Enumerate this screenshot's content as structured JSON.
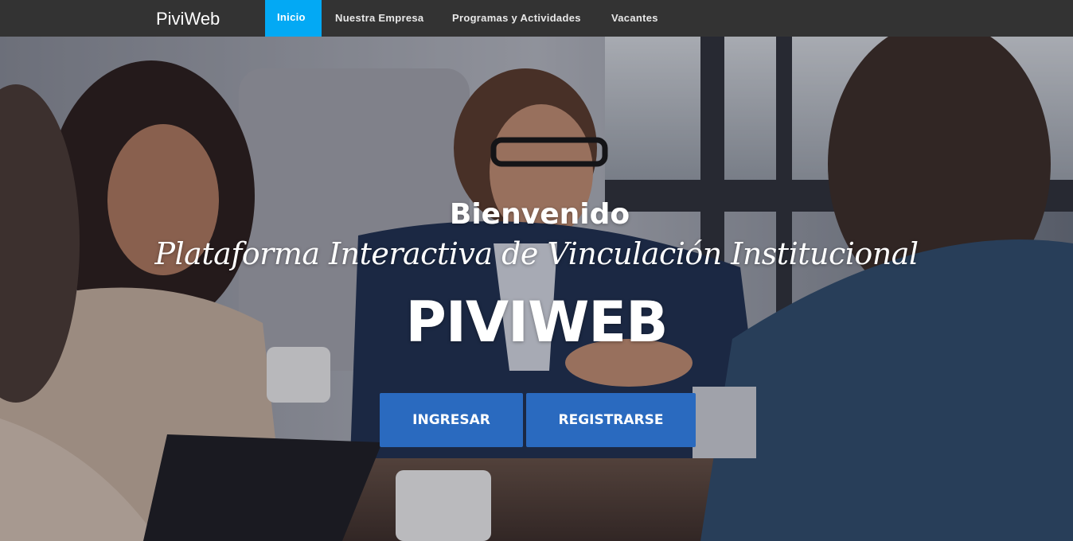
{
  "navbar": {
    "brand": "PiviWeb",
    "items": [
      {
        "label": "Inicio",
        "active": true
      },
      {
        "label": "Nuestra Empresa",
        "active": false
      },
      {
        "label": "Programas y Actividades",
        "active": false
      },
      {
        "label": "Vacantes",
        "active": false
      }
    ],
    "active_color": "#03a9f4",
    "background_color": "#333333"
  },
  "hero": {
    "welcome": "Bienvenido",
    "subtitle": "Plataforma Interactiva de Vinculación Institucional",
    "title": "PIVIWEB",
    "buttons": {
      "login": "INGRESAR",
      "register": "REGISTRARSE"
    },
    "button_color": "#2a6abf"
  }
}
